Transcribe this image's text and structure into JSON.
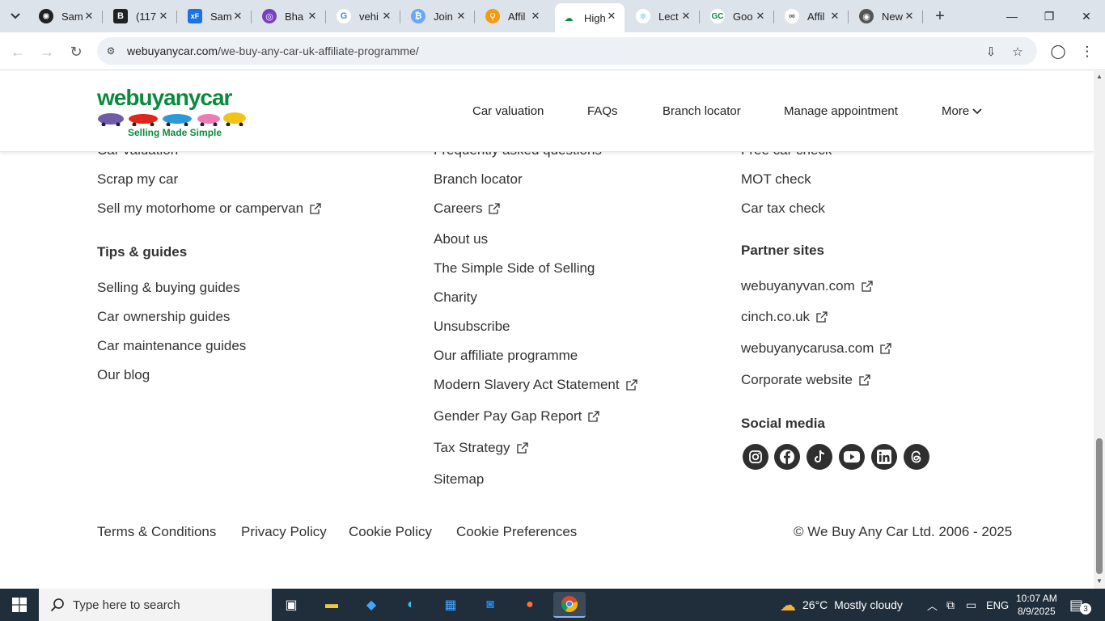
{
  "browser": {
    "tabs": [
      {
        "title": "Sam",
        "icon": "openai-icon",
        "color": "#202124"
      },
      {
        "title": "(117",
        "icon": "b-icon",
        "color": "#202124"
      },
      {
        "title": "Sam",
        "icon": "xf-icon",
        "color": "#1a73e8"
      },
      {
        "title": "Bha",
        "icon": "purple-icon",
        "color": "#7b3fbf"
      },
      {
        "title": "vehi",
        "icon": "google-icon",
        "color": "#4285f4"
      },
      {
        "title": "Join",
        "icon": "blue-icon",
        "color": "#6aa6ff"
      },
      {
        "title": "Affil",
        "icon": "affiliate-icon",
        "color": "#f39c12"
      },
      {
        "title": "High",
        "icon": "webuyanycar-icon",
        "color": "#0b8a3e"
      },
      {
        "title": "Lect",
        "icon": "react-icon",
        "color": "#23b5d3"
      },
      {
        "title": "Goo",
        "icon": "gc-icon",
        "color": "#0b8a3e"
      },
      {
        "title": "Affil",
        "icon": "link-icon",
        "color": "#555555"
      },
      {
        "title": "New",
        "icon": "chrome-icon",
        "color": "#555555"
      }
    ],
    "active_tab_index": 7,
    "url_host": "webuyanycar.com",
    "url_path": "/we-buy-any-car-uk-affiliate-programme/"
  },
  "header": {
    "logo_text": "webuyanycar",
    "logo_tagline": "Selling Made Simple",
    "nav": [
      "Car valuation",
      "FAQs",
      "Branch locator",
      "Manage appointment",
      "More"
    ]
  },
  "footer": {
    "col1_partial": "Car valuation",
    "col1": [
      "Scrap my car",
      "Sell my motorhome or campervan"
    ],
    "tips_heading": "Tips & guides",
    "tips": [
      "Selling & buying guides",
      "Car ownership guides",
      "Car maintenance guides",
      "Our blog"
    ],
    "col2_partial": "Frequently asked questions",
    "col2": [
      "Branch locator",
      "Careers",
      "About us",
      "The Simple Side of Selling",
      "Charity",
      "Unsubscribe",
      "Our affiliate programme",
      "Modern Slavery Act Statement",
      "Gender Pay Gap Report",
      "Tax Strategy",
      "Sitemap"
    ],
    "col3_partial": "Free car check",
    "col3": [
      "MOT check",
      "Car tax check"
    ],
    "partner_heading": "Partner sites",
    "partners": [
      "webuyanyvan.com",
      "cinch.co.uk",
      "webuyanycarusa.com",
      "Corporate website"
    ],
    "social_heading": "Social media",
    "social": [
      "instagram-icon",
      "facebook-icon",
      "tiktok-icon",
      "youtube-icon",
      "linkedin-icon",
      "threads-icon"
    ],
    "bottom_links": [
      "Terms & Conditions",
      "Privacy Policy",
      "Cookie Policy",
      "Cookie Preferences"
    ],
    "copyright": "© We Buy Any Car Ltd. 2006 - 2025"
  },
  "taskbar": {
    "search_placeholder": "Type here to search",
    "weather_temp": "26°C",
    "weather_text": "Mostly cloudy",
    "language": "ENG",
    "time": "10:07 AM",
    "date": "8/9/2025",
    "notification_count": "3"
  },
  "colors": {
    "brand_green": "#0b8a3e",
    "tabstrip": "#dde3ea",
    "taskbar": "#202e3c"
  }
}
